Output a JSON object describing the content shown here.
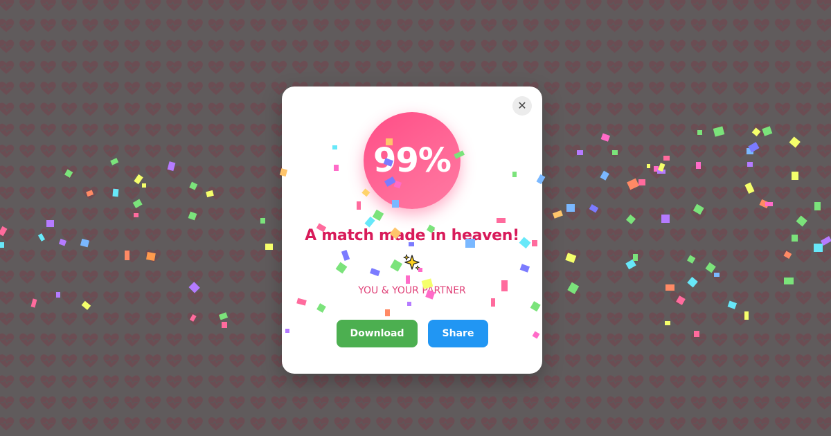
{
  "modal": {
    "score": "99%",
    "headline": "A match made in heaven!",
    "sparkle_emoji": "sparkles-icon",
    "names": "YOU & YOUR PARTNER",
    "close_symbol": "✕",
    "download_label": "Download",
    "share_label": "Share"
  },
  "colors": {
    "background": "#5f5b5c",
    "heart_pattern": "#6e4f56",
    "score_circle": "#ff5a8e",
    "headline": "#d81b5a",
    "names": "#e0447a",
    "download_button": "#4caf50",
    "share_button": "#2196f3"
  }
}
